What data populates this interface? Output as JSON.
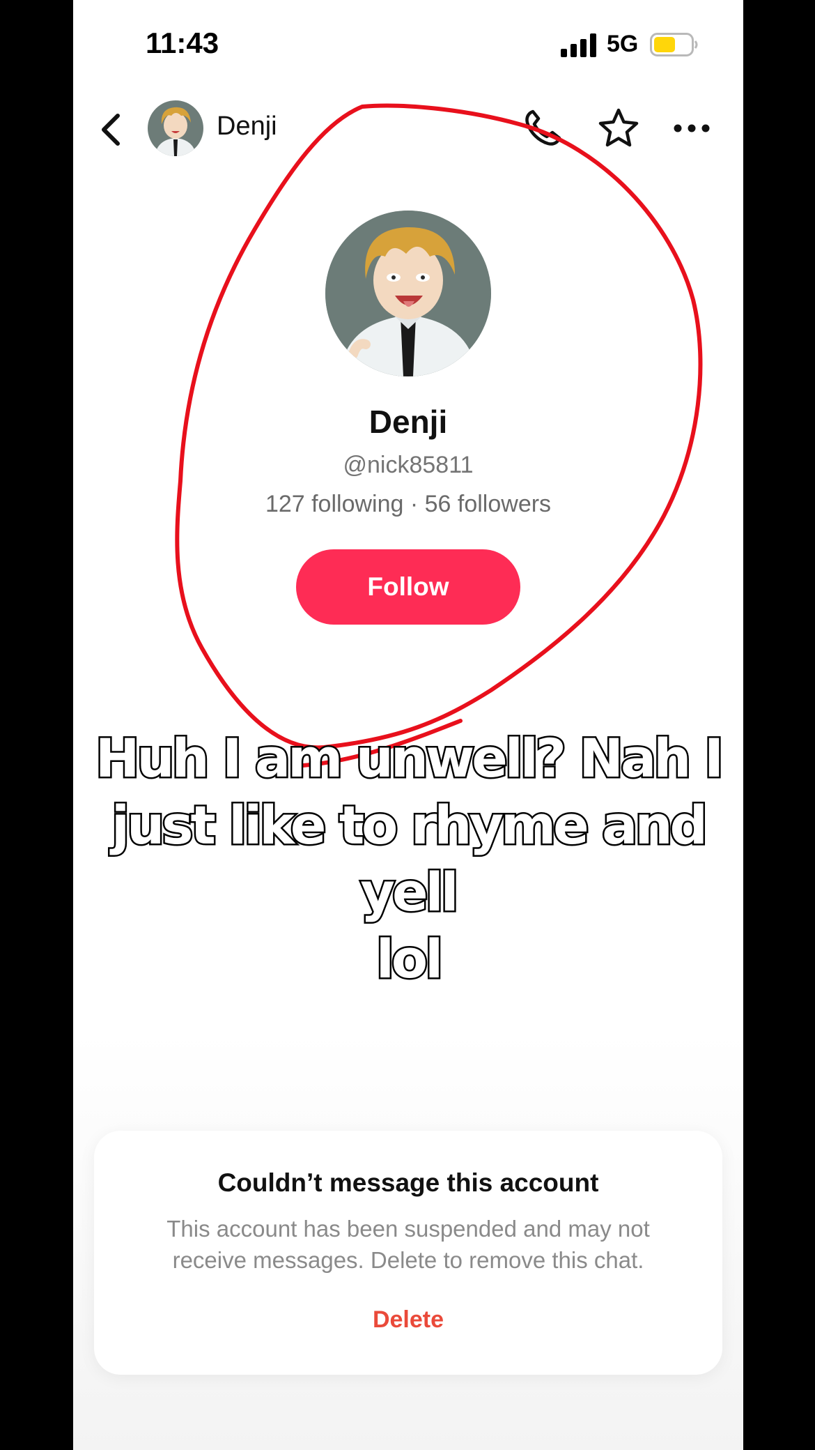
{
  "status_bar": {
    "time": "11:43",
    "network": "5G",
    "battery_color": "#ffd60a"
  },
  "header": {
    "name": "Denji"
  },
  "profile": {
    "display_name": "Denji",
    "username": "@nick85811",
    "stats": "127 following · 56 followers",
    "follow_label": "Follow"
  },
  "caption": {
    "lines": [
      "Huh I am unwell? Nah I",
      "just like to rhyme and yell",
      "lol"
    ]
  },
  "notice": {
    "title": "Couldn’t message this account",
    "body": "This account has been suspended and may not receive messages. Delete to remove this chat.",
    "delete_label": "Delete"
  },
  "colors": {
    "accent": "#fe2c55",
    "annotation": "#e8101c",
    "delete": "#ea4a3a"
  }
}
